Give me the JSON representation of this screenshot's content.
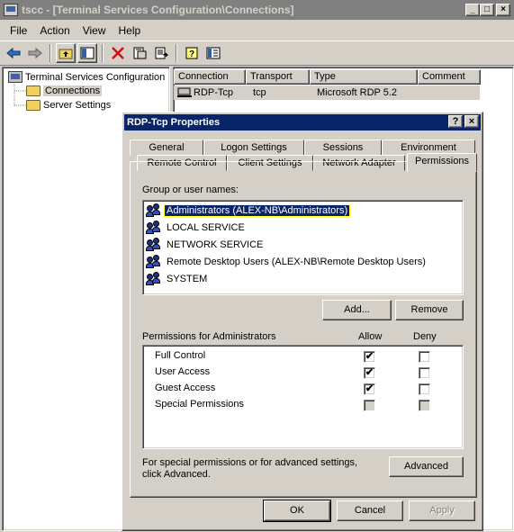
{
  "window": {
    "title": "tscc - [Terminal Services Configuration\\Connections]",
    "controls": [
      "_",
      "□",
      "×"
    ]
  },
  "menu": [
    {
      "label": "File"
    },
    {
      "label": "Action"
    },
    {
      "label": "View"
    },
    {
      "label": "Help"
    }
  ],
  "toolbar": {
    "icons": [
      "back-arrow-icon",
      "forward-arrow-icon",
      "up-folder-icon",
      "show-tree-icon",
      "delete-icon",
      "properties-icon",
      "export-icon",
      "help-icon",
      "console-icon"
    ]
  },
  "tree": {
    "root": "Terminal Services Configuration",
    "children": [
      "Connections",
      "Server Settings"
    ]
  },
  "list": {
    "columns": [
      "Connection",
      "Transport",
      "Type",
      "Comment"
    ],
    "rows": [
      {
        "connection": "RDP-Tcp",
        "transport": "tcp",
        "type": "Microsoft RDP 5.2",
        "comment": ""
      }
    ]
  },
  "dialog": {
    "title": "RDP-Tcp Properties",
    "title_buttons": [
      "?",
      "×"
    ],
    "tabs_back": [
      "General",
      "Logon Settings",
      "Sessions",
      "Environment"
    ],
    "tabs_front": [
      "Remote Control",
      "Client Settings",
      "Network Adapter",
      "Permissions"
    ],
    "active_tab": "Permissions",
    "group_label": "Group or user names:",
    "users": [
      "Administrators (ALEX-NB\\Administrators)",
      "LOCAL SERVICE",
      "NETWORK SERVICE",
      "Remote Desktop Users (ALEX-NB\\Remote Desktop Users)",
      "SYSTEM"
    ],
    "selected_user_index": 0,
    "add_button": "Add...",
    "remove_button": "Remove",
    "perms_label": "Permissions for Administrators",
    "allow_header": "Allow",
    "deny_header": "Deny",
    "permissions": [
      {
        "name": "Full Control",
        "allow": true,
        "deny": false,
        "disabled": false
      },
      {
        "name": "User Access",
        "allow": true,
        "deny": false,
        "disabled": false
      },
      {
        "name": "Guest Access",
        "allow": true,
        "deny": false,
        "disabled": false
      },
      {
        "name": "Special Permissions",
        "allow": false,
        "deny": false,
        "disabled": true
      }
    ],
    "advanced_text_line1": "For special permissions or for advanced settings,",
    "advanced_text_line2": "click Advanced.",
    "advanced_button": "Advanced",
    "ok_button": "OK",
    "cancel_button": "Cancel",
    "apply_button": "Apply"
  }
}
